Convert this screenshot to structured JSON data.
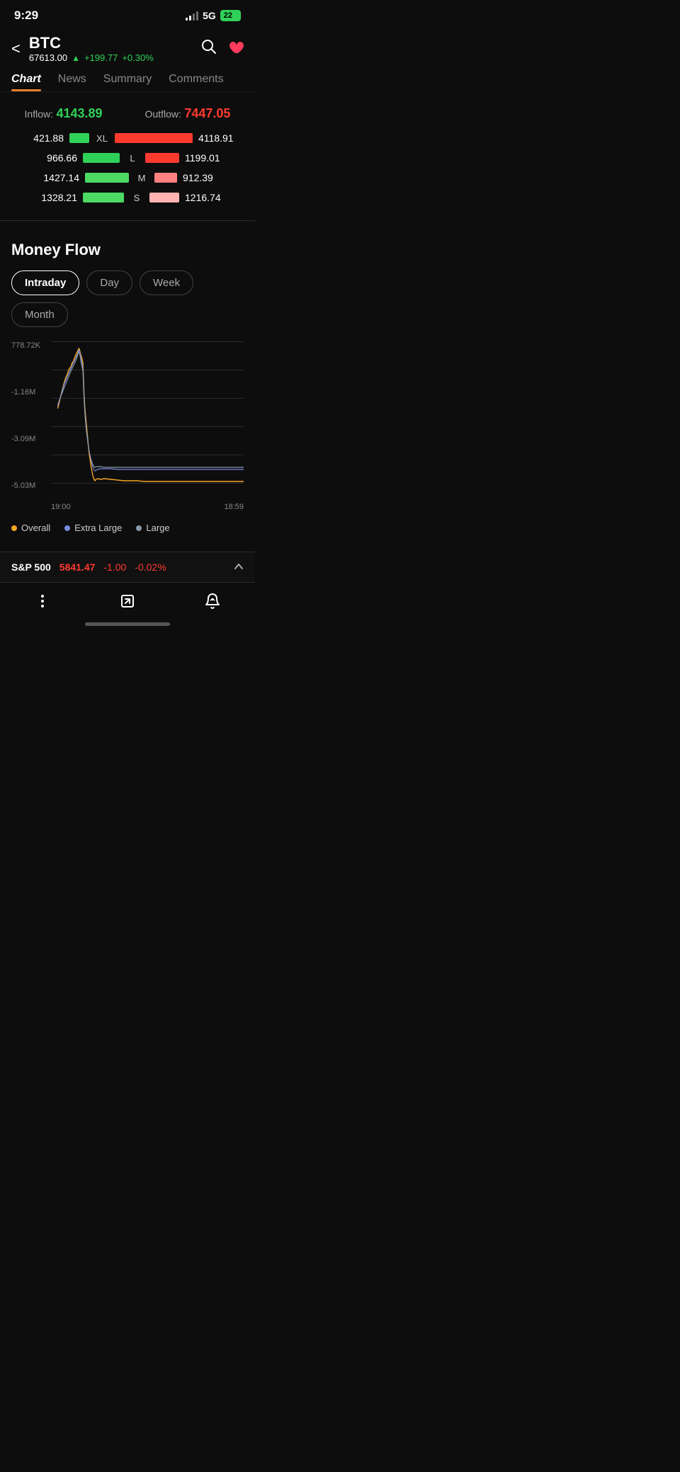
{
  "statusBar": {
    "time": "9:29",
    "network": "5G",
    "battery": "22"
  },
  "header": {
    "ticker": "BTC",
    "price": "67613.00",
    "arrow": "▲",
    "change": "+199.77",
    "pct": "+0.30%",
    "backLabel": "<",
    "searchIcon": "🔍",
    "heartIcon": "♥"
  },
  "tabs": [
    {
      "label": "Chart",
      "active": true
    },
    {
      "label": "News",
      "active": false
    },
    {
      "label": "Summary",
      "active": false
    },
    {
      "label": "Comments",
      "active": false
    }
  ],
  "flow": {
    "inflowLabel": "Inflow:",
    "inflowValue": "4143.89",
    "outflowLabel": "Outflow:",
    "outflowValue": "7447.05",
    "rows": [
      {
        "leftVal": "421.88",
        "size": "XL",
        "rightVal": "4118.91",
        "leftWidth": 28,
        "rightWidth": 110
      },
      {
        "leftVal": "966.66",
        "size": "L",
        "rightVal": "1199.01",
        "leftWidth": 52,
        "rightWidth": 48
      },
      {
        "leftVal": "1427.14",
        "size": "M",
        "rightVal": "912.39",
        "leftWidth": 62,
        "rightWidth": 32
      },
      {
        "leftVal": "1328.21",
        "size": "S",
        "rightVal": "1216.74",
        "leftWidth": 58,
        "rightWidth": 42
      }
    ]
  },
  "moneyFlow": {
    "title": "Money Flow",
    "periods": [
      {
        "label": "Intraday",
        "active": true
      },
      {
        "label": "Day",
        "active": false
      },
      {
        "label": "Week",
        "active": false
      },
      {
        "label": "Month",
        "active": false
      }
    ],
    "yLabels": [
      "778.72K",
      "",
      "-1.16M",
      "",
      "-3.09M",
      "",
      "-5.03M"
    ],
    "xLabels": [
      "19:00",
      "18:59"
    ],
    "gridLines": [
      0,
      28,
      56,
      84,
      112,
      140,
      168
    ],
    "legend": [
      {
        "color": "#f5a623",
        "label": "Overall"
      },
      {
        "color": "#7b8cde",
        "label": "Extra Large"
      },
      {
        "color": "#8899aa",
        "label": "Large"
      }
    ]
  },
  "bottomTicker": {
    "name": "S&P 500",
    "price": "5841.47",
    "change": "-1.00",
    "pct": "-0.02%"
  },
  "bottomNav": {
    "items": [
      {
        "icon": "⋮",
        "name": "more"
      },
      {
        "icon": "↗",
        "name": "share"
      },
      {
        "icon": "🔔",
        "name": "alert"
      }
    ]
  }
}
